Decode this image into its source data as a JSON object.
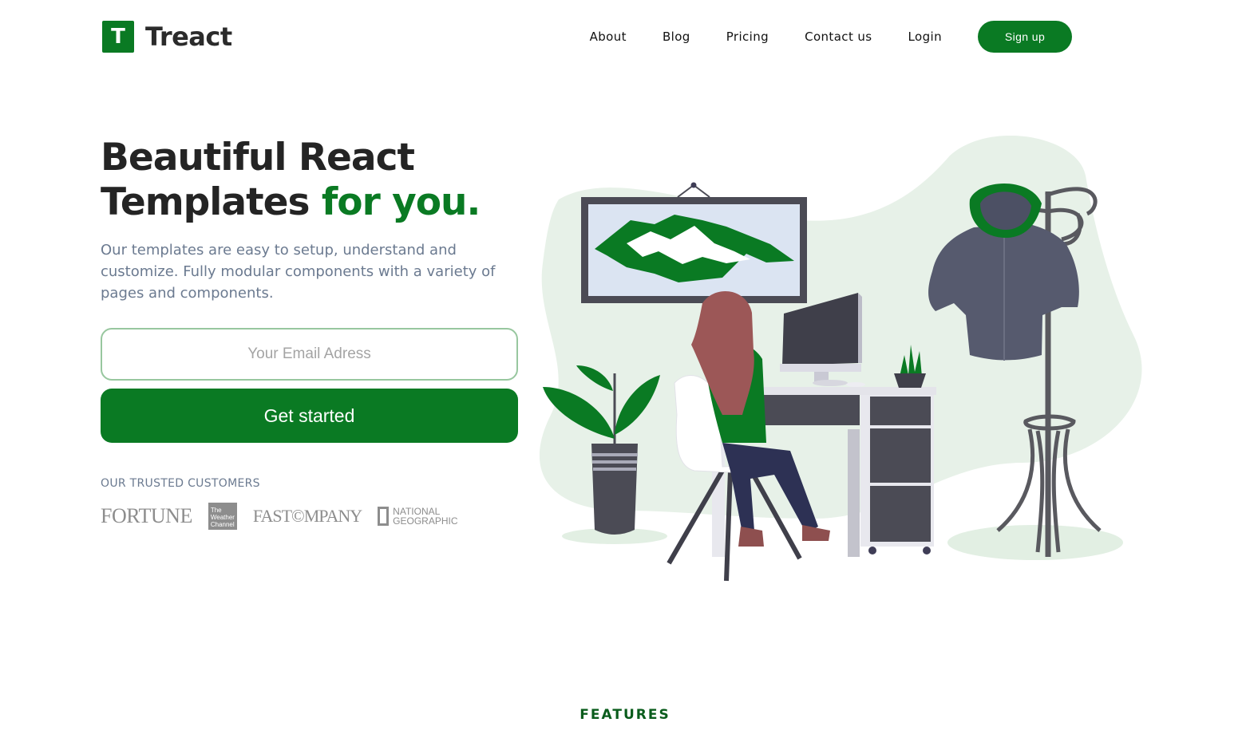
{
  "brand": {
    "logo_letter": "T",
    "name": "Treact"
  },
  "nav": {
    "items": [
      "About",
      "Blog",
      "Pricing",
      "Contact us",
      "Login"
    ],
    "signup_label": "Sign up"
  },
  "hero": {
    "title_line1": "Beautiful React",
    "title_line2": "Templates",
    "title_accent": "for you.",
    "description": "Our templates are easy to setup, understand and customize. Fully modular components with a variety of pages and components.",
    "email_placeholder": "Your Email Adress",
    "cta_label": "Get started"
  },
  "trusted": {
    "heading": "OUR TRUSTED CUSTOMERS",
    "logos": [
      "FORTUNE",
      "The Weather Channel",
      "FAST COMPANY",
      "NATIONAL GEOGRAPHIC"
    ],
    "twc_lines": [
      "The",
      "Weather",
      "Channel"
    ],
    "fastco": "FAST©MPANY",
    "natgeo_lines": [
      "NATIONAL",
      "GEOGRAPHIC"
    ]
  },
  "features_label": "FEATURES",
  "colors": {
    "primary": "#0a7a23",
    "text": "#242424",
    "muted": "#6b7a90"
  }
}
